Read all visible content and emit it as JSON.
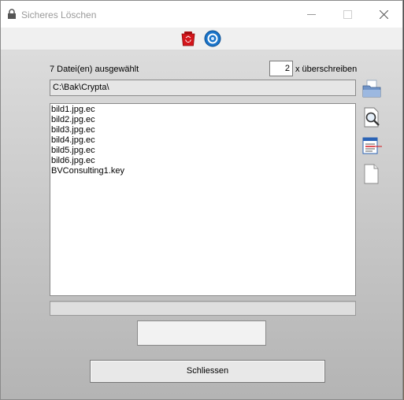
{
  "window": {
    "title": "Sicheres Löschen"
  },
  "toolbar": {
    "icons": [
      "trash-icon",
      "target-icon"
    ]
  },
  "main": {
    "files_selected": "7 Datei(en) ausgewählt",
    "passes_value": "2",
    "passes_label": "x überschreiben",
    "path": "C:\\Bak\\Crypta\\",
    "files": [
      "bild1.jpg.ec",
      "bild2.jpg.ec",
      "bild3.jpg.ec",
      "bild4.jpg.ec",
      "bild5.jpg.ec",
      "bild6.jpg.ec",
      "BVConsulting1.key"
    ],
    "progress": 0,
    "status_text": "",
    "close_label": "Schliessen"
  },
  "side_icons": [
    "open-folder-icon",
    "search-file-icon",
    "list-view-icon",
    "blank-document-icon"
  ],
  "colors": {
    "title_text": "#9a9a9a",
    "trash_red": "#d4161c",
    "target_blue": "#1a74c9"
  }
}
